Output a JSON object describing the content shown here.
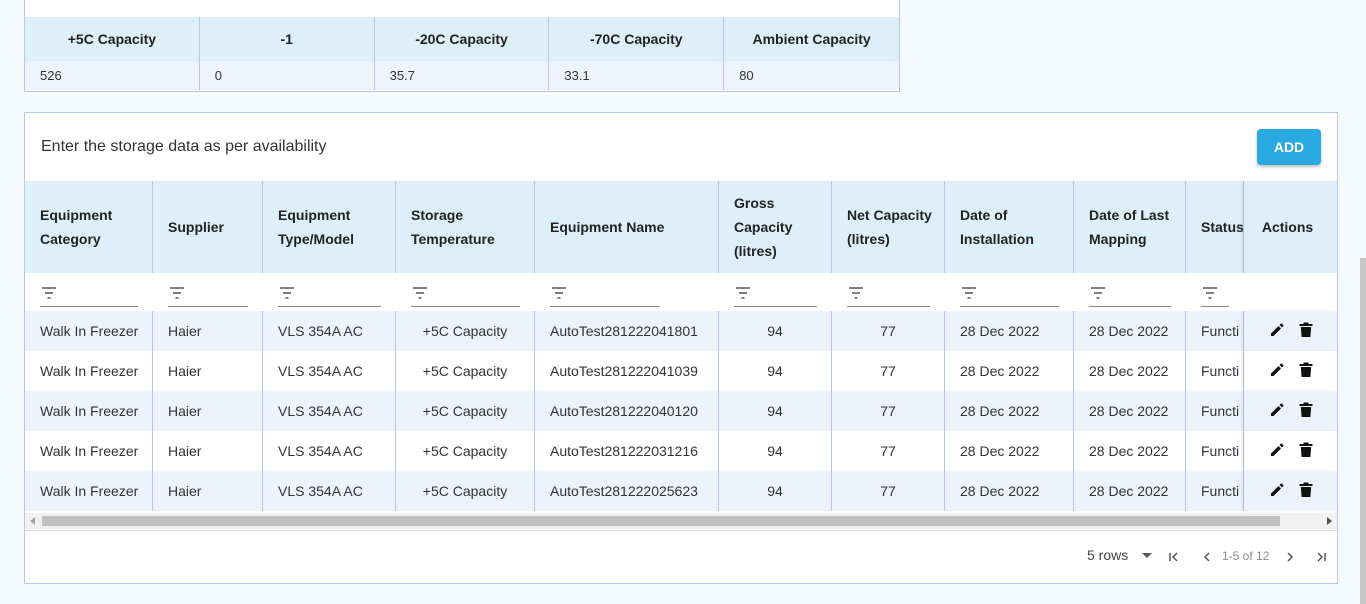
{
  "capacity": {
    "headers": [
      "+5C Capacity",
      "-1",
      "-20C Capacity",
      "-70C Capacity",
      "Ambient Capacity"
    ],
    "values": [
      "526",
      "0",
      "35.7",
      "33.1",
      "80"
    ]
  },
  "storage": {
    "title": "Enter the storage data as per availability",
    "add_label": "ADD",
    "columns": [
      "Equipment Category",
      "Supplier",
      "Equipment Type/Model",
      "Storage Temperature",
      "Equipment Name",
      "Gross Capacity (litres)",
      "Net Capacity (litres)",
      "Date of Installation",
      "Date of Last Mapping",
      "Status",
      "Actions"
    ],
    "rows": [
      [
        "Walk In Freezer",
        "Haier",
        "VLS 354A AC",
        "+5C Capacity",
        "AutoTest281222041801",
        "94",
        "77",
        "28 Dec 2022",
        "28 Dec 2022",
        "Functi"
      ],
      [
        "Walk In Freezer",
        "Haier",
        "VLS 354A AC",
        "+5C Capacity",
        "AutoTest281222041039",
        "94",
        "77",
        "28 Dec 2022",
        "28 Dec 2022",
        "Functi"
      ],
      [
        "Walk In Freezer",
        "Haier",
        "VLS 354A AC",
        "+5C Capacity",
        "AutoTest281222040120",
        "94",
        "77",
        "28 Dec 2022",
        "28 Dec 2022",
        "Functi"
      ],
      [
        "Walk In Freezer",
        "Haier",
        "VLS 354A AC",
        "+5C Capacity",
        "AutoTest281222031216",
        "94",
        "77",
        "28 Dec 2022",
        "28 Dec 2022",
        "Functi"
      ],
      [
        "Walk In Freezer",
        "Haier",
        "VLS 354A AC",
        "+5C Capacity",
        "AutoTest281222025623",
        "94",
        "77",
        "28 Dec 2022",
        "28 Dec 2022",
        "Functi"
      ]
    ],
    "pagination": {
      "rows_per_page": "5 rows",
      "range": "1-5 of 12"
    }
  },
  "icons": {
    "edit": "pencil-icon",
    "delete": "trash-icon",
    "filter": "filter-icon"
  },
  "colors": {
    "header_bg": "#ddf0fa",
    "stripe_bg": "#eef2fd",
    "accent": "#29a9e1",
    "border": "#b5c7ec"
  }
}
